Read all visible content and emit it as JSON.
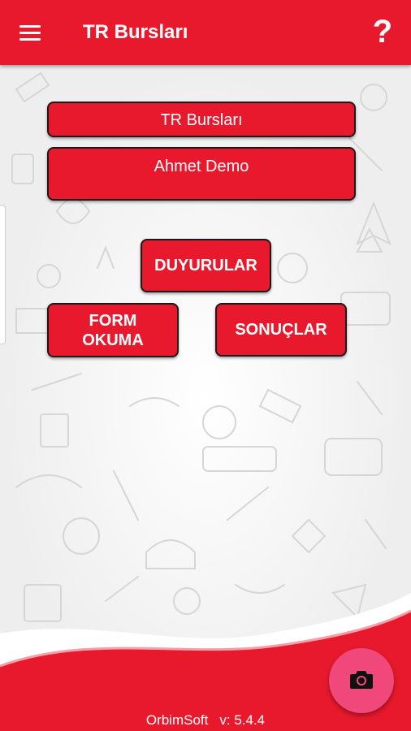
{
  "app_bar": {
    "title": "TR Bursları",
    "menu_icon": "hamburger-menu-icon",
    "help_icon": "question-mark-icon",
    "help_glyph": "?",
    "color": "#e8192c"
  },
  "main": {
    "info_title": "TR Bursları",
    "user_name": "Ahmet Demo",
    "buttons": {
      "duyurular": "DUYURULAR",
      "form_okuma_line1": "FORM",
      "form_okuma_line2": "OKUMA",
      "sonuclar": "SONUÇLAR"
    }
  },
  "footer": {
    "company": "OrbimSoft",
    "version": "v: 5.4.4"
  },
  "fab": {
    "icon": "camera-icon",
    "color": "#f0487a"
  }
}
